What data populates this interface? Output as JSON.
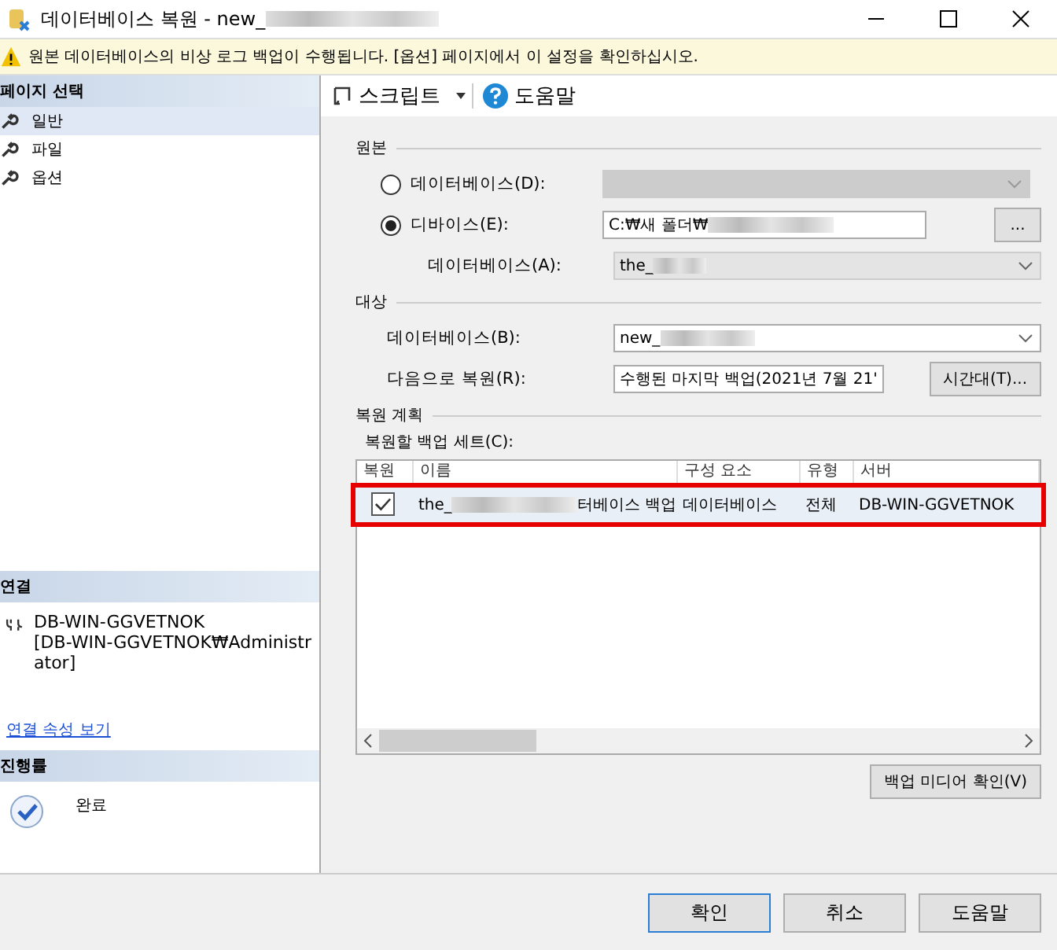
{
  "window": {
    "title": "데이터베이스 복원 - new_"
  },
  "warning": "원본 데이터베이스의 비상 로그 백업이 수행됩니다. [옵션] 페이지에서 이 설정을 확인하십시오.",
  "sidebar": {
    "title": "페이지 선택",
    "items": [
      {
        "label": "일반",
        "selected": true
      },
      {
        "label": "파일",
        "selected": false
      },
      {
        "label": "옵션",
        "selected": false
      }
    ]
  },
  "connection": {
    "title": "연결",
    "server": "DB-WIN-GGVETNOK",
    "login": "[DB-WIN-GGVETNOK₩Administrator]",
    "link": "연결 속성 보기"
  },
  "progress": {
    "title": "진행률",
    "status": "완료"
  },
  "toolbar": {
    "script": "스크립트",
    "help": "도움말"
  },
  "source": {
    "title": "원본",
    "options": [
      {
        "label": "데이터베이스(D):",
        "selected": false
      },
      {
        "label": "디바이스(E):",
        "selected": true,
        "value": "C:₩새 폴더₩"
      }
    ],
    "database_label": "데이터베이스(A):",
    "database_value": "the_",
    "browse": "..."
  },
  "destination": {
    "title": "대상",
    "database_label": "데이터베이스(B):",
    "database_value": "new_",
    "restore_to_label": "다음으로 복원(R):",
    "restore_to_value": "수행된 마지막 백업(2021년 7월 21'",
    "timeline": "시간대(T)..."
  },
  "plan": {
    "title": "복원 계획",
    "sets_label": "복원할 백업 세트(C):",
    "columns": [
      "복원",
      "이름",
      "구성 요소",
      "유형",
      "서버"
    ],
    "rows": [
      {
        "checked": true,
        "name_start": "the_",
        "name_end": "터베이스 백업",
        "component": "데이터베이스",
        "type": "전체",
        "server": "DB-WIN-GGVETNOK",
        "highlighted": true
      }
    ],
    "verify": "백업 미디어 확인(V)"
  },
  "buttons": [
    "확인",
    "취소",
    "도움말"
  ]
}
